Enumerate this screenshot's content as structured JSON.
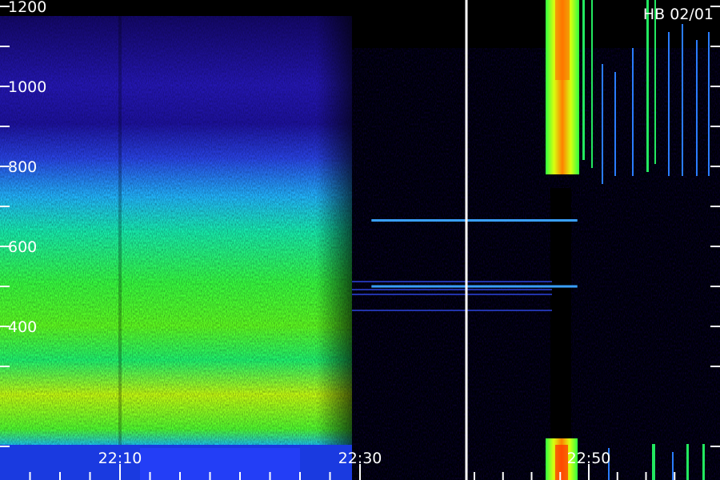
{
  "chart_data": {
    "type": "heatmap",
    "title": "",
    "xlabel": "",
    "ylabel": "",
    "station_label": "HB 02/01",
    "y_ticks": [
      {
        "value": 1200,
        "label": "1200"
      },
      {
        "value": 1000,
        "label": "1000"
      },
      {
        "value": 800,
        "label": "800"
      },
      {
        "value": 600,
        "label": "600"
      },
      {
        "value": 400,
        "label": "400"
      }
    ],
    "x_ticks": [
      {
        "value": "22:10",
        "label": "22:10"
      },
      {
        "value": "22:30",
        "label": "22:30"
      },
      {
        "value": "22:50",
        "label": "22:50"
      }
    ],
    "ylim": [
      0,
      1200
    ],
    "xlim": [
      "22:02",
      "22:59"
    ],
    "gap_time": "22:41",
    "colormap": [
      "#000000",
      "#1a0a6e",
      "#2a22d8",
      "#2aa8ff",
      "#18e8c8",
      "#30ff30",
      "#d8ff10",
      "#ff9000",
      "#ff2000"
    ],
    "features": [
      {
        "name": "broadband-noise-band",
        "t_start": "22:02",
        "t_end": "22:32",
        "f_low": 0,
        "f_high": 1150
      },
      {
        "name": "narrowband-line",
        "t_start": "22:31",
        "t_end": "22:49",
        "f": 500
      },
      {
        "name": "narrowband-line",
        "t_start": "22:31",
        "t_end": "22:49",
        "f": 665
      },
      {
        "name": "burst",
        "t_start": "22:47",
        "t_end": "22:51",
        "f_low": 820,
        "f_high": 1220
      },
      {
        "name": "burst",
        "t_start": "22:47",
        "t_end": "22:52",
        "f_low": 0,
        "f_high": 90
      }
    ]
  }
}
